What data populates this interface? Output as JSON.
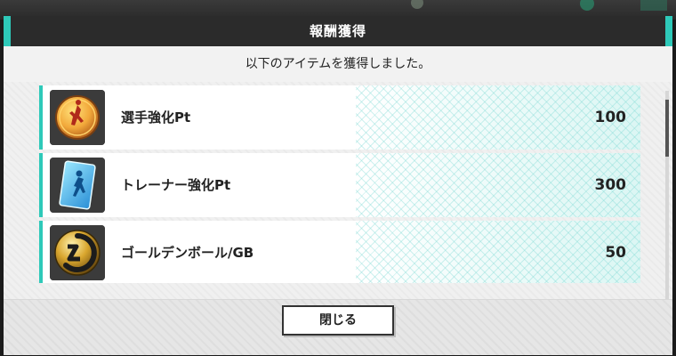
{
  "dialog": {
    "title": "報酬獲得",
    "message": "以下のアイテムを獲得しました。",
    "close_label": "閉じる"
  },
  "rewards": [
    {
      "name": "選手強化Pt",
      "quantity": "100",
      "icon": "player-boost-medal-icon"
    },
    {
      "name": "トレーナー強化Pt",
      "quantity": "300",
      "icon": "trainer-boost-card-icon"
    },
    {
      "name": "ゴールデンボール/GB",
      "quantity": "50",
      "icon": "golden-ball-icon"
    }
  ],
  "colors": {
    "accent": "#2ec9b9",
    "header": "#2b2b2b",
    "text": "#222222"
  }
}
